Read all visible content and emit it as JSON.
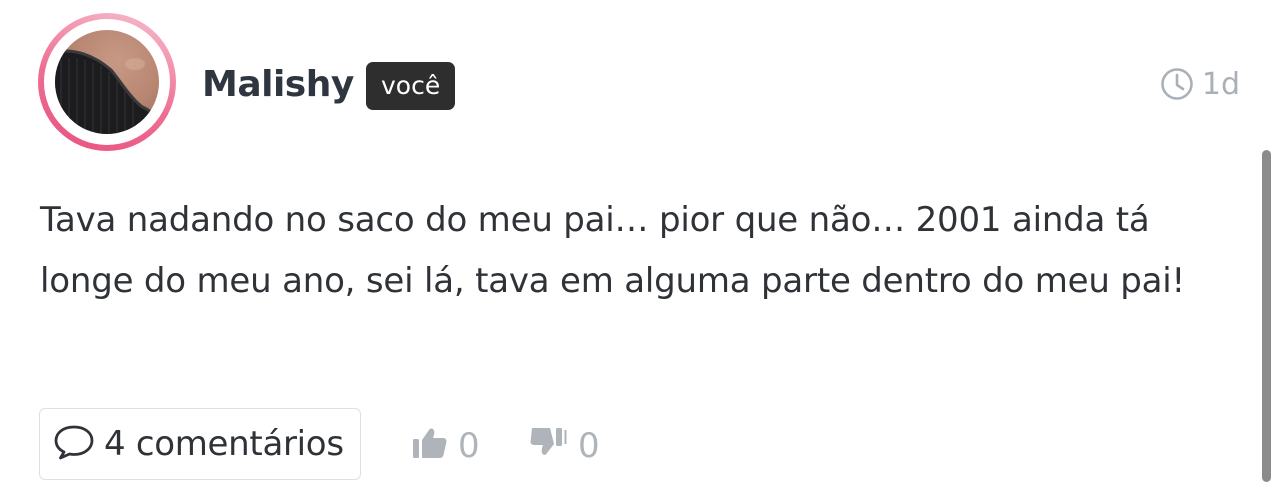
{
  "post": {
    "author": "Malishy",
    "you_badge": "você",
    "time_ago": "1d",
    "text": "Tava nadando no saco do meu pai… pior que não… 2001 ainda tá longe do meu ano, sei lá, tava em alguma parte dentro do meu pai!",
    "comments_label": "4 comentários",
    "likes": "0",
    "dislikes": "0"
  },
  "icons": {
    "time": "clock-icon",
    "comments": "speech-bubble-icon",
    "like": "thumbs-up-icon",
    "dislike": "thumbs-down-icon"
  },
  "colors": {
    "avatar_ring": "#ee6f93",
    "badge_bg": "#2e2e2e",
    "muted": "#a9b0b8"
  }
}
